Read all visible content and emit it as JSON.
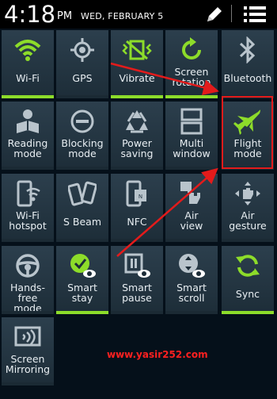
{
  "status_bar": {
    "time": "4:18",
    "ampm": "PM",
    "date": "WED, FEBRUARY 5",
    "edit_icon": "pencil-icon",
    "menu_icon": "list-menu-icon"
  },
  "accent_color": "#8ddc2a",
  "highlight_color": "#e31b1b",
  "tiles": [
    {
      "label": "Wi-Fi",
      "icon": "wifi-icon",
      "on": true
    },
    {
      "label": "GPS",
      "icon": "gps-icon",
      "on": false
    },
    {
      "label": "Vibrate",
      "icon": "vibrate-icon",
      "on": true
    },
    {
      "label": "Screen rotation",
      "icon": "screen-rotation-icon",
      "on": true
    },
    {
      "label": "Bluetooth",
      "icon": "bluetooth-icon",
      "on": false
    },
    {
      "label": "Reading mode",
      "icon": "reading-mode-icon",
      "on": false
    },
    {
      "label": "Blocking mode",
      "icon": "blocking-mode-icon",
      "on": false
    },
    {
      "label": "Power saving",
      "icon": "power-saving-icon",
      "on": false
    },
    {
      "label": "Multi window",
      "icon": "multi-window-icon",
      "on": false
    },
    {
      "label": "Flight mode",
      "icon": "airplane-icon",
      "on": false
    },
    {
      "label": "Wi-Fi hotspot",
      "icon": "wifi-hotspot-icon",
      "on": false
    },
    {
      "label": "S Beam",
      "icon": "s-beam-icon",
      "on": false
    },
    {
      "label": "NFC",
      "icon": "nfc-icon",
      "on": false
    },
    {
      "label": "Air view",
      "icon": "air-view-icon",
      "on": false
    },
    {
      "label": "Air gesture",
      "icon": "air-gesture-icon",
      "on": false
    },
    {
      "label": "Hands-free mode",
      "icon": "steering-wheel-icon",
      "on": false
    },
    {
      "label": "Smart stay",
      "icon": "smart-stay-icon",
      "on": true
    },
    {
      "label": "Smart pause",
      "icon": "smart-pause-icon",
      "on": false
    },
    {
      "label": "Smart scroll",
      "icon": "smart-scroll-icon",
      "on": false
    },
    {
      "label": "Sync",
      "icon": "sync-icon",
      "on": true
    },
    {
      "label": "Screen Mirroring",
      "icon": "screen-mirroring-icon",
      "on": false
    }
  ],
  "watermark": "www.yasir252.com"
}
